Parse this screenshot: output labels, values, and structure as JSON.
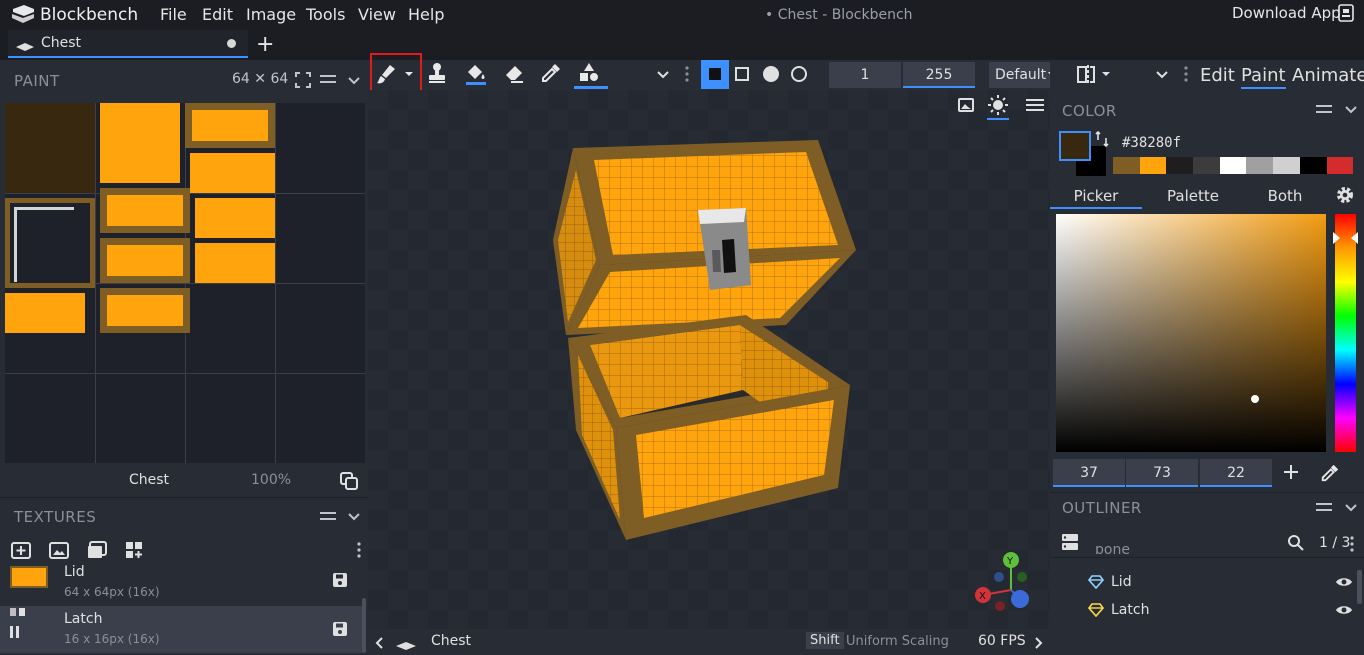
{
  "menubar": {
    "app_name": "Blockbench",
    "items": [
      "File",
      "Edit",
      "Image",
      "Tools",
      "View",
      "Help"
    ],
    "window_title": "• Chest - Blockbench",
    "download": "Download App"
  },
  "tabs": {
    "active": "Chest",
    "new_tab": "+"
  },
  "paint_panel": {
    "title": "PAINT",
    "size": "64 ✕ 64",
    "texture_name": "Chest",
    "zoom": "100%"
  },
  "textures_panel": {
    "title": "TEXTURES",
    "items": [
      {
        "name": "Lid",
        "meta": "64 x 64px (16x)"
      },
      {
        "name": "Latch",
        "meta": "16 x 16px (16x)"
      }
    ]
  },
  "toolbar": {
    "brush_size": "1",
    "opacity": "255",
    "blend_mode": "Default"
  },
  "modes": [
    "Edit",
    "Paint",
    "Animate"
  ],
  "active_mode": "Paint",
  "statusbar": {
    "model_name": "Chest",
    "shift_key": "Shift",
    "shift_hint": "Uniform Scaling",
    "fps": "60 FPS"
  },
  "color_panel": {
    "title": "COLOR",
    "hex": "#38280f",
    "current_color": "#38280f",
    "palette": [
      "#7f5e26",
      "#ffa40c",
      "#1e1e1e",
      "#3c3c3c",
      "#ffffff",
      "#a0a0a0",
      "#d0d0d0",
      "#000000",
      "#d42c2c"
    ],
    "tabs": [
      "Picker",
      "Palette",
      "Both"
    ],
    "rgb": {
      "r": "37",
      "g": "73",
      "b": "22"
    }
  },
  "outliner": {
    "title": "OUTLINER",
    "count": "1 / 3",
    "partial_item": "bone",
    "items": [
      {
        "name": "Lid"
      },
      {
        "name": "Latch"
      }
    ]
  },
  "icons": [
    "blockbench-logo-icon",
    "paintbrush-icon",
    "stamp-icon",
    "fill-bucket-icon",
    "eraser-icon",
    "eyedropper-icon",
    "shapes-icon",
    "search-icon",
    "eye-icon",
    "save-icon",
    "gear-icon"
  ]
}
